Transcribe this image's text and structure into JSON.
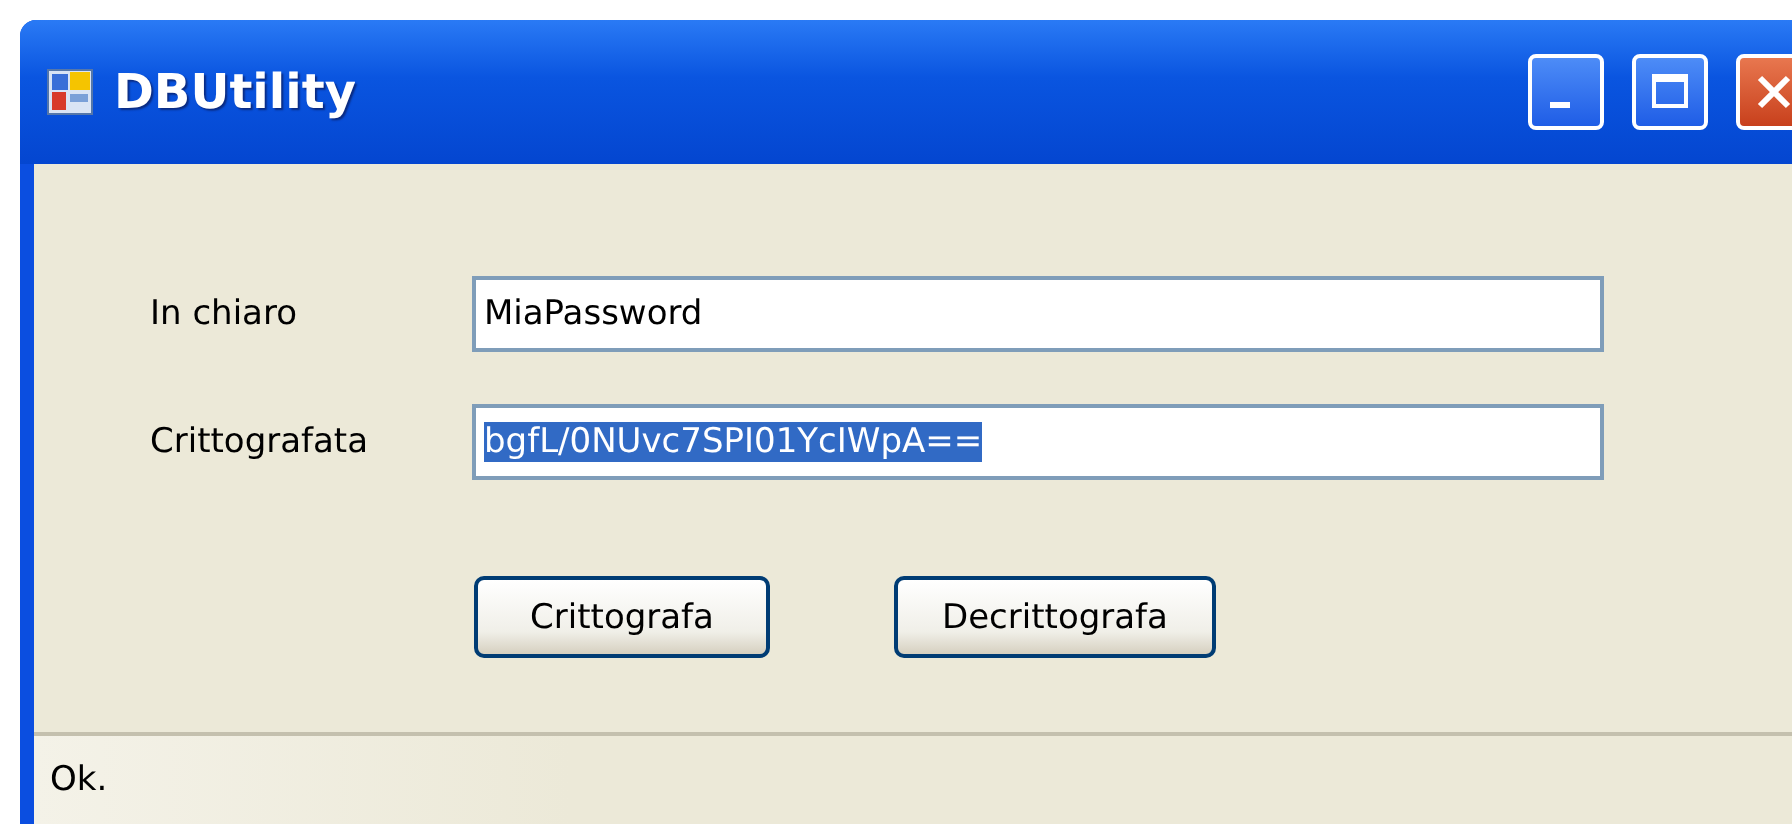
{
  "window": {
    "title": "DBUtility"
  },
  "fields": [
    {
      "label": "In chiaro",
      "value": "MiaPassword",
      "text_selected": false
    },
    {
      "label": "Crittografata",
      "value": "bgfL/0NUvc7SPI01YcIWpA==",
      "text_selected": true
    }
  ],
  "buttons": [
    "Crittografa",
    "Decrittografa"
  ],
  "status_bar": {
    "text": "Ok."
  }
}
